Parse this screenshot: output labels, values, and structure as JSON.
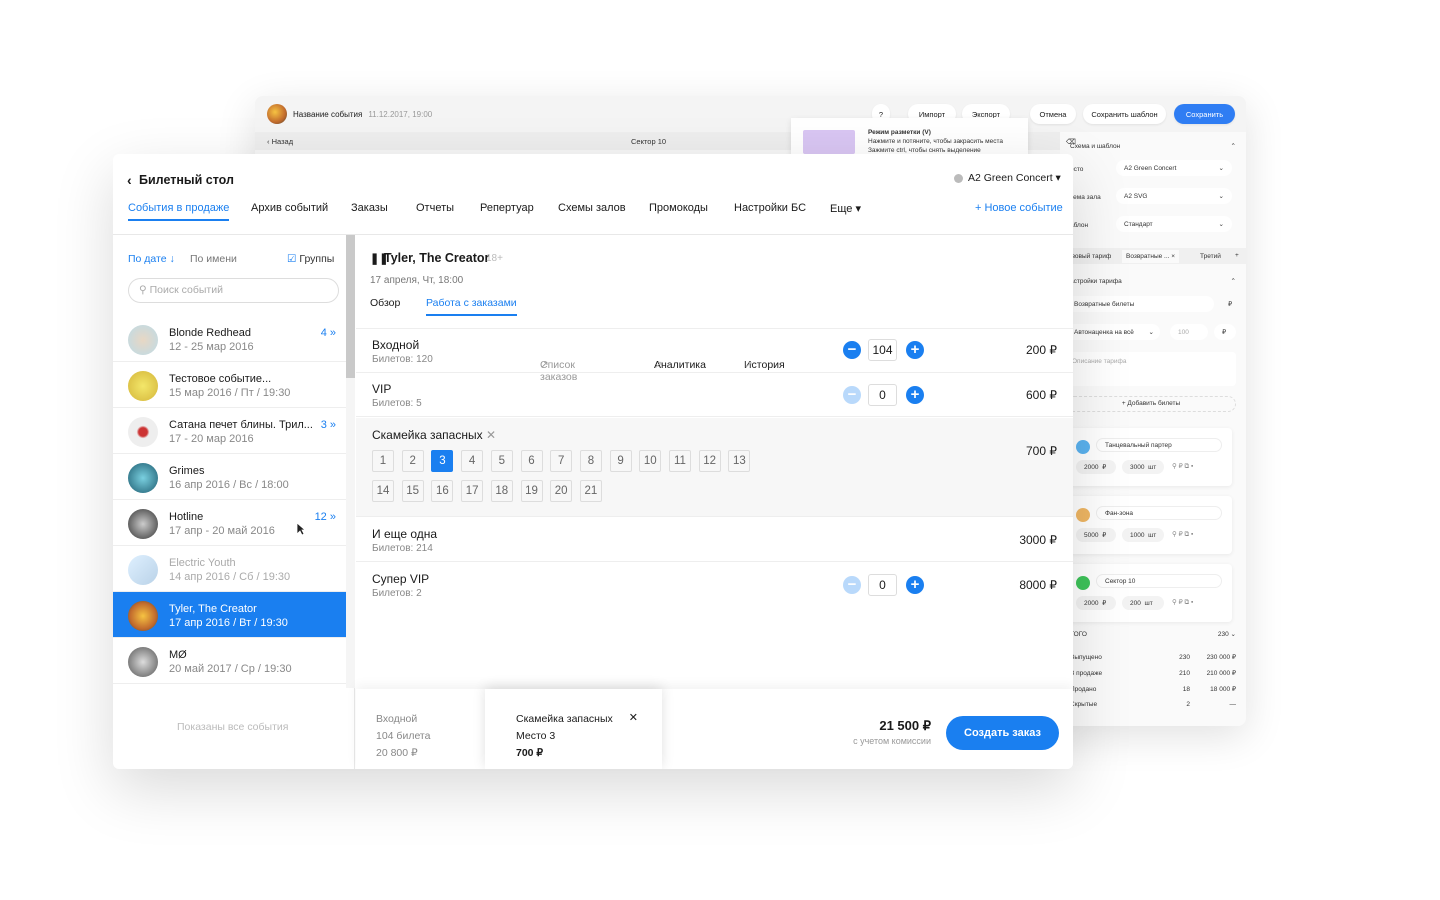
{
  "back": {
    "event_name": "Название события",
    "event_date": "11.12.2017, 19:00",
    "q": "?",
    "import": "Импорт",
    "export": "Экспорт",
    "cancel": "Отмена",
    "save_template": "Сохранить шаблон",
    "save": "Сохранить",
    "back": "‹ Назад",
    "sector": "Сектор 10",
    "tip_title": "Режим разметки (V)",
    "tip_line1": "Нажмите и потяните, чтобы закрасить места",
    "tip_line2": "Зажмите ctrl, чтобы снять выделение",
    "schema_title": "Схема и шаблон",
    "venue_label": "есто",
    "venue_value": "A2 Green Concert",
    "hall_label": "хема зала",
    "hall_value": "A2 SVG",
    "tpl_label": "аблон",
    "tpl_value": "Стандарт",
    "tab1": "зовый тариф",
    "tab2": "Возвратные ...",
    "tab3": "Третий",
    "tab_add": "+",
    "tariff_title": "астройки тарифа",
    "tariff_name": "Возвратные билеты",
    "currency": "₽",
    "markup": "Автонаценка на всё",
    "markup_val": "100",
    "markup_cur": "₽",
    "desc": "Описание тарифа",
    "add_tickets": "+ Добавить билеты",
    "cards": [
      {
        "name": "Танцевальный партер",
        "price": "2000",
        "cur": "₽",
        "qty": "3000",
        "unit": "шт",
        "color": "#5bb3f0"
      },
      {
        "name": "Фан-зона",
        "price": "5000",
        "cur": "₽",
        "qty": "1000",
        "unit": "шт",
        "color": "#f0b764"
      },
      {
        "name": "Сектор 10",
        "price": "2000",
        "cur": "₽",
        "qty": "200",
        "unit": "шт",
        "color": "#3ec45a"
      }
    ],
    "total_label": "ТОГО",
    "total_val": "230",
    "stats": [
      {
        "l": "Выпущено",
        "a": "230",
        "b": "230 000 ₽"
      },
      {
        "l": "В продаже",
        "a": "210",
        "b": "210 000 ₽"
      },
      {
        "l": "Продано",
        "a": "18",
        "b": "18 000 ₽"
      },
      {
        "l": "Скрытые",
        "a": "2",
        "b": "—"
      }
    ]
  },
  "header": {
    "title": "Билетный стол",
    "venue": "A2 Green Concert",
    "nav": [
      "События в продаже",
      "Архив событий",
      "Заказы",
      "Отчеты",
      "Репертуар",
      "Схемы залов",
      "Промокоды",
      "Настройки БС",
      "Еще"
    ],
    "new_event": "+ Новое событие"
  },
  "left": {
    "sort_date": "По дате",
    "sort_name": "По имени",
    "groups": "Группы",
    "search_placeholder": "Поиск событий",
    "all_shown": "Показаны все события",
    "events": [
      {
        "name": "Blonde Redhead",
        "date": "12 - 25 мар 2016",
        "count": "4"
      },
      {
        "name": "Тестовое событие...",
        "date": "15 мар 2016 / Пт / 19:30",
        "count": ""
      },
      {
        "name": "Сатана печет блины. Трил...",
        "date": "17 - 20 мар 2016",
        "count": "3"
      },
      {
        "name": "Grimes",
        "date": "16 апр 2016 / Вс / 18:00",
        "count": ""
      },
      {
        "name": "Hotline",
        "date": "17 апр  - 20 май 2016",
        "count": "12"
      },
      {
        "name": "Electric Youth",
        "date": "14 апр 2016 / Сб / 19:30",
        "count": ""
      },
      {
        "name": "Tyler, The Creator",
        "date": "17 апр 2016 / Вт / 19:30",
        "count": ""
      },
      {
        "name": "MØ",
        "date": "20 май 2017 / Ср / 19:30",
        "count": ""
      }
    ]
  },
  "event": {
    "title": "Tyler, The Creator",
    "age": "18+",
    "date": "17 апреля, Чт, 18:00",
    "tabs": [
      "Обзор",
      "Работа с заказами",
      "Список заказов",
      "Аналитика",
      "История"
    ]
  },
  "tickets": [
    {
      "name": "Входной",
      "sub": "Билетов: 120",
      "qty": "104",
      "price": "200 ₽"
    },
    {
      "name": "VIP",
      "sub": "Билетов: 5",
      "qty": "0",
      "price": "600 ₽"
    },
    {
      "name": "Скамейка запасных",
      "sub": "",
      "qty": "",
      "price": "700 ₽"
    },
    {
      "name": "И еще одна",
      "sub": "Билетов: 214",
      "qty": "",
      "price": "3000 ₽"
    },
    {
      "name": "Супер VIP",
      "sub": "Билетов: 2",
      "qty": "0",
      "price": "8000 ₽"
    }
  ],
  "seats": [
    "1",
    "2",
    "3",
    "4",
    "5",
    "6",
    "7",
    "8",
    "9",
    "10",
    "11",
    "12",
    "13",
    "14",
    "15",
    "16",
    "17",
    "18",
    "19",
    "20",
    "21"
  ],
  "selected_seat": "3",
  "footer": {
    "s1_name": "Входной",
    "s1_qty": "104 билета",
    "s1_sum": "20 800 ₽",
    "s2_name": "Скамейка запасных",
    "s2_seat": "Место 3",
    "s2_sum": "700 ₽",
    "total": "21 500 ₽",
    "total_note": "с учетом комиссии",
    "create": "Создать заказ"
  }
}
